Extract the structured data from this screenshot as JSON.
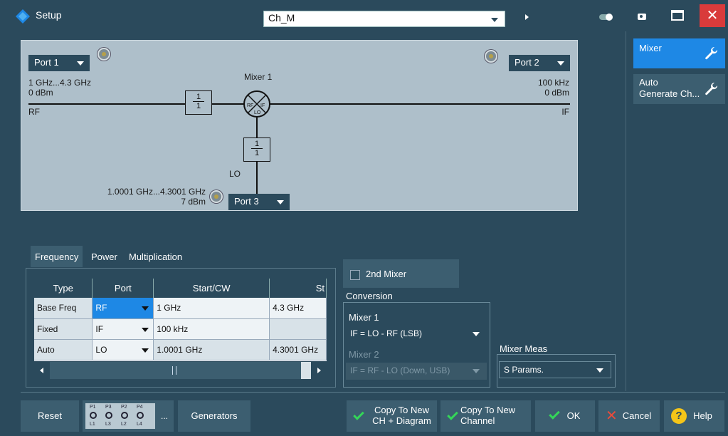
{
  "window": {
    "title": "Setup",
    "channel": "Ch_M"
  },
  "diagram": {
    "port1": "Port 1",
    "port2": "Port 2",
    "port3": "Port 3",
    "rf_range": "1 GHz...4.3 GHz",
    "rf_power": "0 dBm",
    "rf_label": "RF",
    "if_freq": "100 kHz",
    "if_power": "0 dBm",
    "if_label": "IF",
    "mixer_title": "Mixer 1",
    "lo_label": "LO",
    "lo_range": "1.0001 GHz...4.3001 GHz",
    "lo_power": "7 dBm",
    "ratio_num": "1",
    "ratio_den": "1",
    "mixer_rf": "RF",
    "mixer_if": "IF",
    "mixer_lo": "LO"
  },
  "right_panel": {
    "mixer": "Mixer",
    "auto_line1": "Auto",
    "auto_line2": "Generate Ch..."
  },
  "tabs": [
    "Frequency",
    "Power",
    "Multiplication"
  ],
  "table": {
    "headers": [
      "Type",
      "Port",
      "Start/CW",
      "St"
    ],
    "rows": [
      {
        "type": "Base Freq",
        "port": "RF",
        "start": "1 GHz",
        "stop": "4.3 GHz"
      },
      {
        "type": "Fixed",
        "port": "IF",
        "start": "100 kHz",
        "stop": ""
      },
      {
        "type": "Auto",
        "port": "LO",
        "start": "1.0001 GHz",
        "stop": "4.3001 GHz"
      }
    ]
  },
  "conversion": {
    "second_mixer": "2nd Mixer",
    "label": "Conversion",
    "mixer1_label": "Mixer 1",
    "mixer1_value": "IF = LO - RF (LSB)",
    "mixer2_label": "Mixer 2",
    "mixer2_value": "IF = RF - LO (Down, USB)"
  },
  "mixer_meas": {
    "label": "Mixer Meas",
    "value": "S Params."
  },
  "bottom": {
    "reset": "Reset",
    "ports_top": [
      "P1",
      "P3",
      "P2",
      "P4"
    ],
    "ports_bottom": [
      "L1",
      "L3",
      "L2",
      "L4"
    ],
    "ellipsis": "...",
    "generators": "Generators",
    "copy_new_diag_1": "Copy To New",
    "copy_new_diag_2": "CH + Diagram",
    "copy_new_ch_1": "Copy To New",
    "copy_new_ch_2": "Channel",
    "ok": "OK",
    "cancel": "Cancel",
    "help": "Help"
  },
  "colors": {
    "background": "#2b4a5c",
    "accent": "#1e88e5",
    "close": "#d93b3b",
    "check": "#34d658"
  }
}
